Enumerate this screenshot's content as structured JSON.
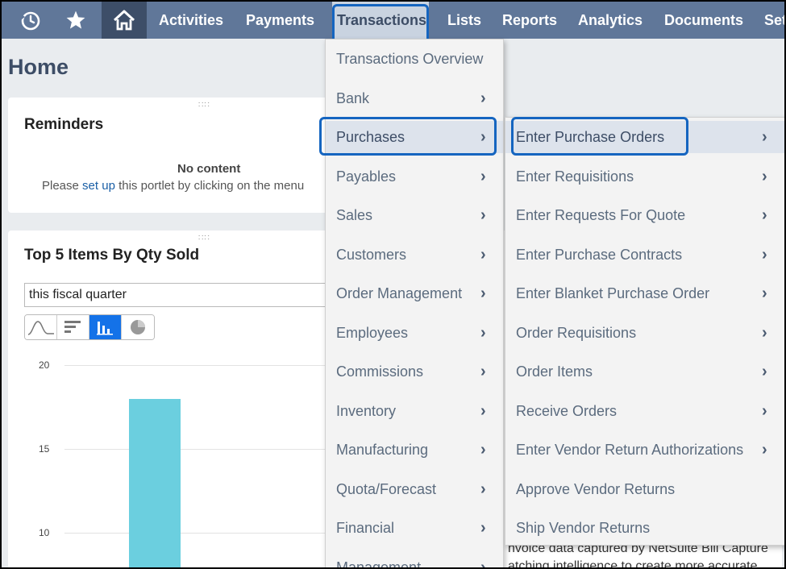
{
  "nav": {
    "items": [
      {
        "label": "Activities",
        "active": false
      },
      {
        "label": "Payments",
        "active": false
      },
      {
        "label": "Transactions",
        "active": true
      },
      {
        "label": "Lists",
        "active": false
      },
      {
        "label": "Reports",
        "active": false
      },
      {
        "label": "Analytics",
        "active": false
      },
      {
        "label": "Documents",
        "active": false
      },
      {
        "label": "Set",
        "active": false
      }
    ],
    "icons": [
      "recent-records-icon",
      "star-icon",
      "home-icon"
    ]
  },
  "page": {
    "title": "Home"
  },
  "reminders": {
    "title": "Reminders",
    "no_content": "No content",
    "msg_before": "Please ",
    "msg_link": "set up",
    "msg_after": " this portlet by clicking on the menu"
  },
  "top_items": {
    "title": "Top 5 Items By Qty Sold",
    "period": "this fiscal quarter",
    "chart_types": [
      "line",
      "bar-horizontal",
      "column",
      "pie"
    ],
    "selected_chart_type": "column"
  },
  "chart_data": {
    "type": "bar",
    "categories": [
      ""
    ],
    "values": [
      18
    ],
    "title": "",
    "xlabel": "",
    "ylabel": "",
    "yticks": [
      20,
      15,
      10
    ]
  },
  "background_text": {
    "line1": "nvoice data captured by NetSuite Bill Capture",
    "line2": "atching intelligence to create more accurate"
  },
  "menu": {
    "transactions": [
      {
        "label": "Transactions Overview",
        "chevron": false,
        "active": false
      },
      {
        "label": "Bank",
        "chevron": true,
        "active": false
      },
      {
        "label": "Purchases",
        "chevron": true,
        "active": true
      },
      {
        "label": "Payables",
        "chevron": true,
        "active": false
      },
      {
        "label": "Sales",
        "chevron": true,
        "active": false
      },
      {
        "label": "Customers",
        "chevron": true,
        "active": false
      },
      {
        "label": "Order Management",
        "chevron": true,
        "active": false
      },
      {
        "label": "Employees",
        "chevron": true,
        "active": false
      },
      {
        "label": "Commissions",
        "chevron": true,
        "active": false
      },
      {
        "label": "Inventory",
        "chevron": true,
        "active": false
      },
      {
        "label": "Manufacturing",
        "chevron": true,
        "active": false
      },
      {
        "label": "Quota/Forecast",
        "chevron": true,
        "active": false
      },
      {
        "label": "Financial",
        "chevron": true,
        "active": false
      },
      {
        "label": "Management",
        "chevron": true,
        "active": false
      }
    ],
    "purchases": [
      {
        "label": "Enter Purchase Orders",
        "chevron": true,
        "active": true
      },
      {
        "label": "Enter Requisitions",
        "chevron": true,
        "active": false
      },
      {
        "label": "Enter Requests For Quote",
        "chevron": true,
        "active": false
      },
      {
        "label": "Enter Purchase Contracts",
        "chevron": true,
        "active": false
      },
      {
        "label": "Enter Blanket Purchase Order",
        "chevron": true,
        "active": false
      },
      {
        "label": "Order Requisitions",
        "chevron": true,
        "active": false
      },
      {
        "label": "Order Items",
        "chevron": true,
        "active": false
      },
      {
        "label": "Receive Orders",
        "chevron": true,
        "active": false
      },
      {
        "label": "Enter Vendor Return Authorizations",
        "chevron": true,
        "active": false
      },
      {
        "label": "Approve Vendor Returns",
        "chevron": false,
        "active": false
      },
      {
        "label": "Ship Vendor Returns",
        "chevron": false,
        "active": false
      }
    ]
  }
}
